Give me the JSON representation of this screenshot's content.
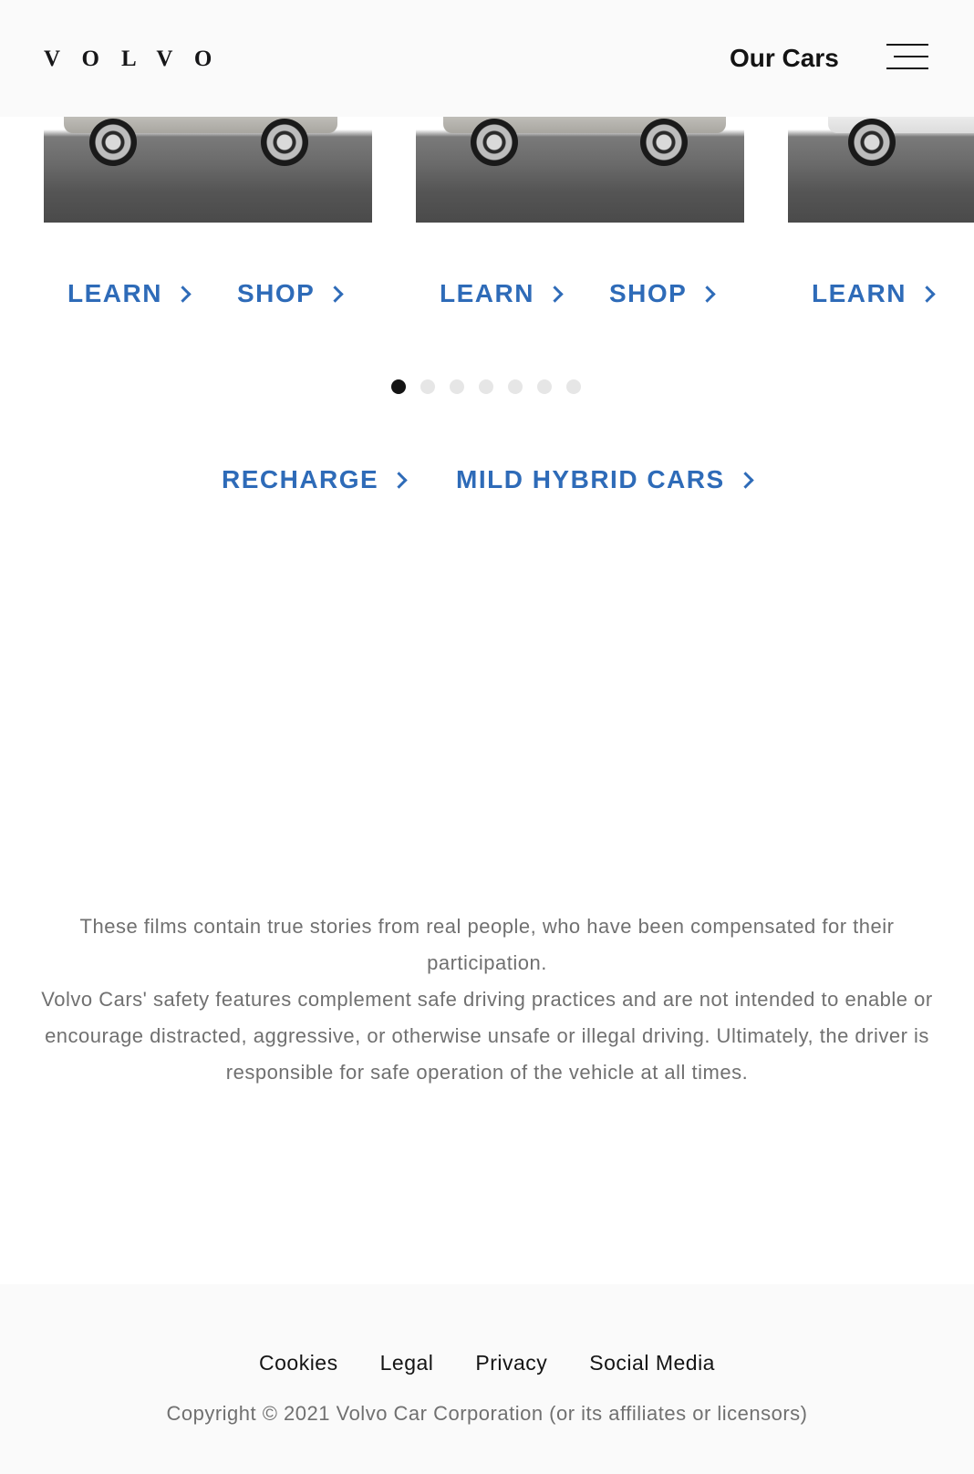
{
  "header": {
    "logo_text": "VOLVO",
    "nav_title": "Our Cars",
    "menu_icon": "hamburger-menu-icon"
  },
  "cars": [
    {
      "links": [
        {
          "label": "LEARN"
        },
        {
          "label": "SHOP"
        }
      ]
    },
    {
      "links": [
        {
          "label": "LEARN"
        },
        {
          "label": "SHOP"
        }
      ]
    },
    {
      "links": [
        {
          "label": "LEARN"
        }
      ]
    }
  ],
  "carousel": {
    "dot_count": 7,
    "active_index": 0
  },
  "categories": [
    {
      "label": "RECHARGE"
    },
    {
      "label": "MILD HYBRID CARS"
    }
  ],
  "disclaimer": [
    "These films contain true stories from real people, who have been compensated for their participation.",
    "Volvo Cars' safety features complement safe driving practices and are not intended to enable or encourage distracted, aggressive, or otherwise unsafe or illegal driving. Ultimately, the driver is responsible for safe operation of the vehicle at all times."
  ],
  "footer": {
    "links": [
      {
        "label": "Cookies"
      },
      {
        "label": "Legal"
      },
      {
        "label": "Privacy"
      },
      {
        "label": "Social Media"
      }
    ],
    "copyright": "Copyright © 2021 Volvo Car Corporation (or its affiliates or licensors)"
  },
  "colors": {
    "link_blue": "#2e6bb8",
    "header_bg": "#fafafa",
    "text_dark": "#141414",
    "text_muted": "#707070"
  }
}
